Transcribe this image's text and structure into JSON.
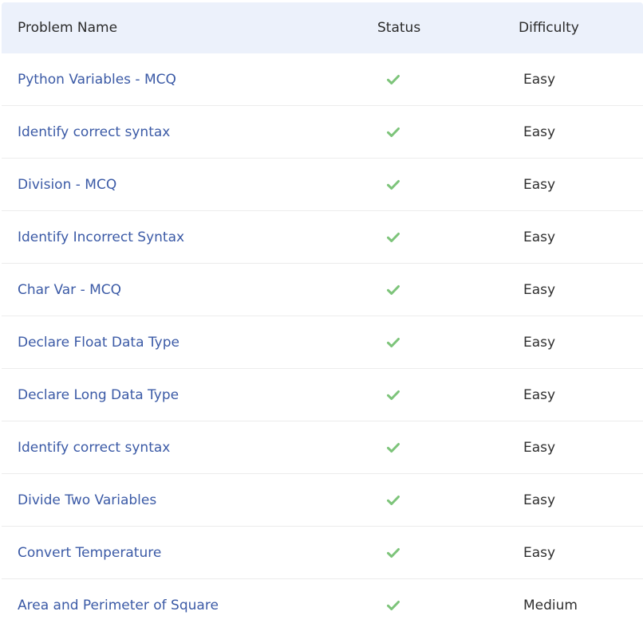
{
  "header": {
    "name": "Problem Name",
    "status": "Status",
    "difficulty": "Difficulty"
  },
  "status_color": "#7dc47a",
  "link_color": "#3b5aa6",
  "rows": [
    {
      "name": "Python Variables - MCQ",
      "status": "check-icon",
      "difficulty": "Easy"
    },
    {
      "name": "Identify correct syntax",
      "status": "check-icon",
      "difficulty": "Easy"
    },
    {
      "name": "Division - MCQ",
      "status": "check-icon",
      "difficulty": "Easy"
    },
    {
      "name": "Identify Incorrect Syntax",
      "status": "check-icon",
      "difficulty": "Easy"
    },
    {
      "name": "Char Var - MCQ",
      "status": "check-icon",
      "difficulty": "Easy"
    },
    {
      "name": "Declare Float Data Type",
      "status": "check-icon",
      "difficulty": "Easy"
    },
    {
      "name": "Declare Long Data Type",
      "status": "check-icon",
      "difficulty": "Easy"
    },
    {
      "name": "Identify correct syntax",
      "status": "check-icon",
      "difficulty": "Easy"
    },
    {
      "name": "Divide Two Variables",
      "status": "check-icon",
      "difficulty": "Easy"
    },
    {
      "name": "Convert Temperature",
      "status": "check-icon",
      "difficulty": "Easy"
    },
    {
      "name": "Area and Perimeter of Square",
      "status": "check-icon",
      "difficulty": "Medium"
    }
  ]
}
